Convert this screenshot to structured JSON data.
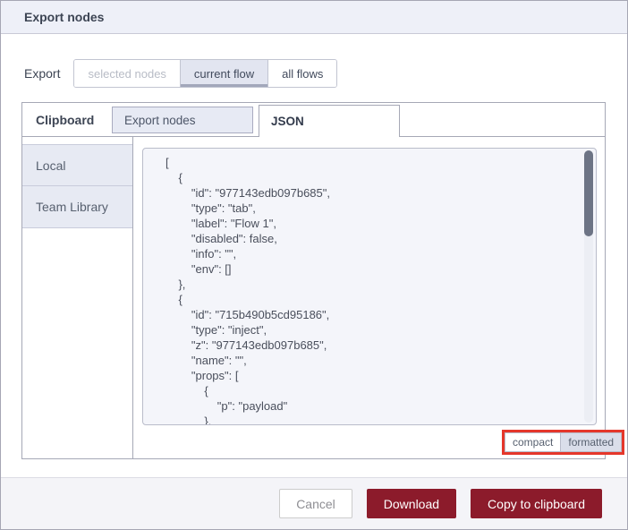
{
  "dialog": {
    "title": "Export nodes"
  },
  "export_row": {
    "label": "Export",
    "options": [
      {
        "label": "selected nodes",
        "state": "disabled"
      },
      {
        "label": "current flow",
        "state": "selected"
      },
      {
        "label": "all flows",
        "state": "normal"
      }
    ]
  },
  "tabs": {
    "section_label": "Clipboard",
    "inactive_tab": "Export nodes",
    "active_tab": "JSON"
  },
  "library_sidebar": {
    "items": [
      {
        "label": "Local"
      },
      {
        "label": "Team Library"
      }
    ]
  },
  "json_editor": {
    "content": "[\n    {\n        \"id\": \"977143edb097b685\",\n        \"type\": \"tab\",\n        \"label\": \"Flow 1\",\n        \"disabled\": false,\n        \"info\": \"\",\n        \"env\": []\n    },\n    {\n        \"id\": \"715b490b5cd95186\",\n        \"type\": \"inject\",\n        \"z\": \"977143edb097b685\",\n        \"name\": \"\",\n        \"props\": [\n            {\n                \"p\": \"payload\"\n            },",
    "format_toggle": {
      "compact_label": "compact",
      "formatted_label": "formatted",
      "selected": "formatted"
    }
  },
  "footer": {
    "cancel_label": "Cancel",
    "download_label": "Download",
    "copy_label": "Copy to clipboard"
  },
  "colors": {
    "primary_button": "#8c1b2b",
    "annotation_highlight": "#e5372b",
    "header_bg": "#eef0f8",
    "tab_bg": "#e7eaf4",
    "selected_toggle_bg": "#e2e5f0",
    "editor_bg": "#f4f5fa"
  }
}
